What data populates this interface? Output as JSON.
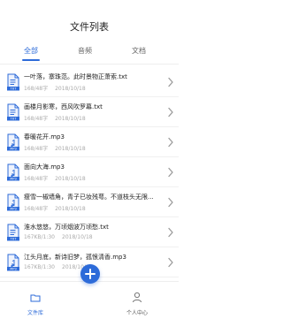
{
  "header": {
    "title": "文件列表"
  },
  "tabs": [
    {
      "label": "全部",
      "active": true
    },
    {
      "label": "音频",
      "active": false
    },
    {
      "label": "文档",
      "active": false
    }
  ],
  "files": [
    {
      "name": "一叶落，寨珠范。此时景物正萧索.txt",
      "size": "168/48字",
      "date": "2018/10/18",
      "kind": "TXT"
    },
    {
      "name": "画楼月影寒，西风吹罗幕.txt",
      "size": "168/48字",
      "date": "2018/10/18",
      "kind": "TXT"
    },
    {
      "name": "春暖花开.mp3",
      "size": "168/48字",
      "date": "2018/10/18",
      "kind": "MP3"
    },
    {
      "name": "面向大海.mp3",
      "size": "168/48字",
      "date": "2018/10/18",
      "kind": "MP3"
    },
    {
      "name": "瘦雪一椒墙角，青子已妆残萼。不道枝头无限...",
      "size": "168/48字",
      "date": "2018/10/18",
      "kind": "MP3"
    },
    {
      "name": "淮水悠悠，万顷烟波万顷愁.txt",
      "size": "167KB/1:30",
      "date": "2018/10/18",
      "kind": "TXT"
    },
    {
      "name": "江头月底，新诗旧梦，孤恨清香.mp3",
      "size": "167KB/1:30",
      "date": "2018/10/18",
      "kind": "MP3"
    }
  ],
  "bottom_nav": {
    "left_label": "文件库",
    "right_label": "个人中心"
  },
  "colors": {
    "accent": "#2d6bd9",
    "text": "#222222",
    "meta": "#aaaaaa"
  }
}
